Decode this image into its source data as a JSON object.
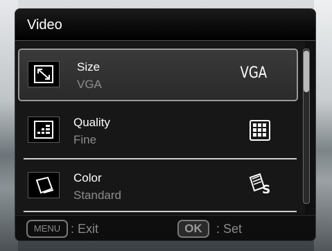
{
  "menu": {
    "title": "Video",
    "items": [
      {
        "label": "Size",
        "value": "VGA",
        "icon": "resize-icon",
        "setting_icon": "vga-text",
        "setting_text": "VGA",
        "selected": true
      },
      {
        "label": "Quality",
        "value": "Fine",
        "icon": "quality-icon",
        "setting_icon": "fine-grid-icon",
        "selected": false
      },
      {
        "label": "Color",
        "value": "Standard",
        "icon": "color-icon",
        "setting_icon": "standard-color-icon",
        "selected": false
      }
    ]
  },
  "footer": {
    "menu_key": "MENU",
    "exit_label": ": Exit",
    "ok_key": "OK",
    "set_label": ": Set"
  },
  "colors": {
    "panel_bg": "#101010",
    "text_primary": "#ffffff",
    "text_secondary": "#8d8d8d",
    "highlight_border": "#9a9a9a"
  }
}
